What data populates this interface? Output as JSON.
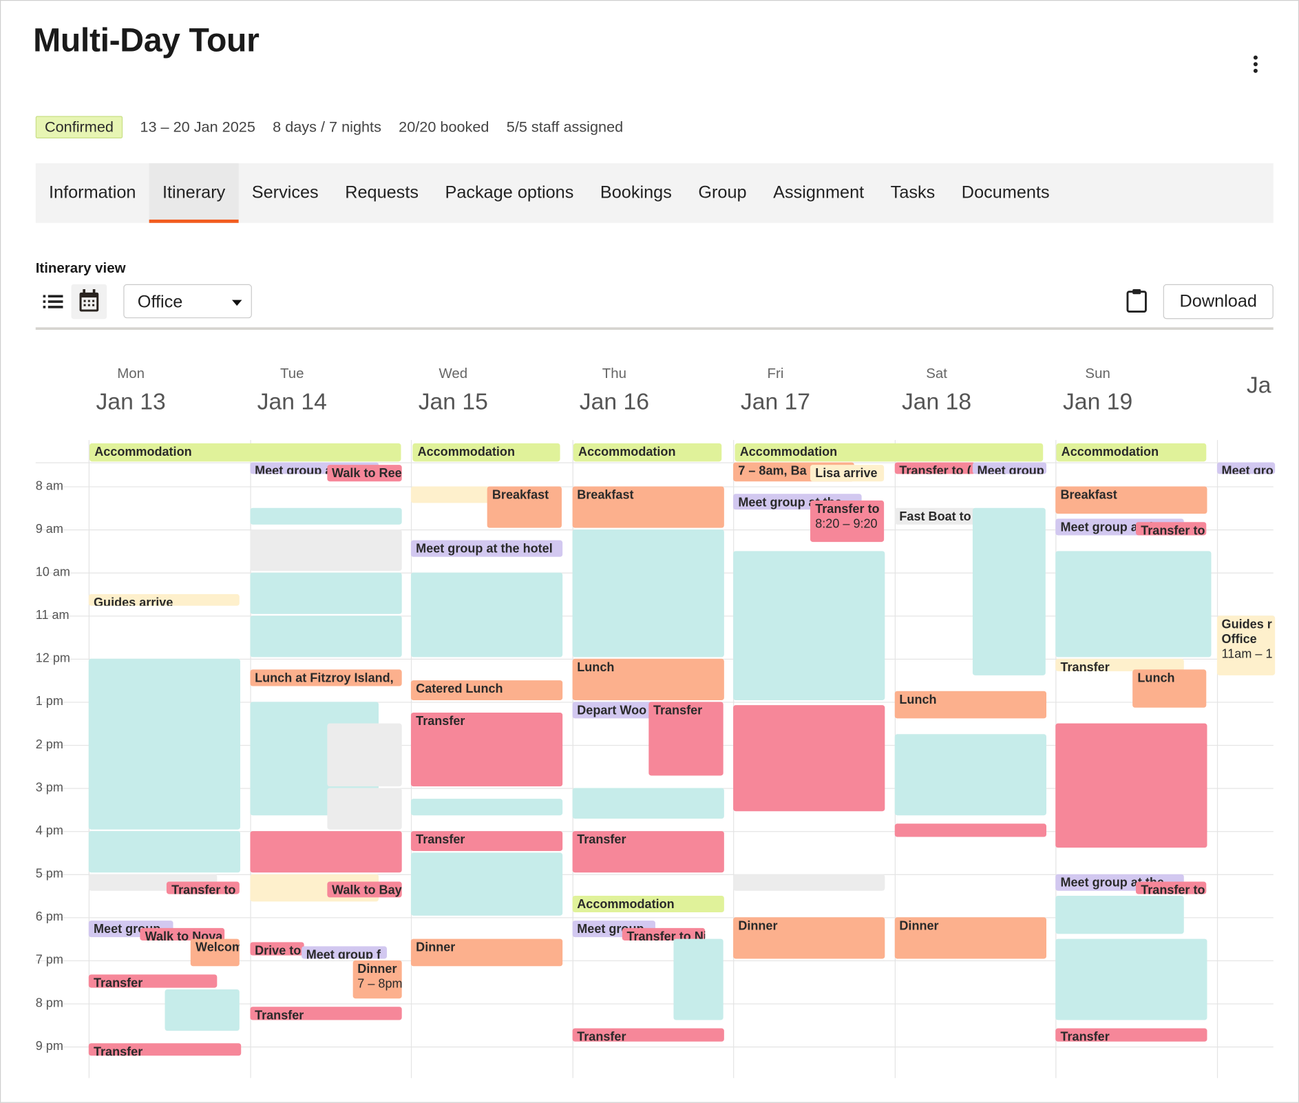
{
  "header": {
    "title": "Multi-Day Tour",
    "menu_icon": "kebab-vertical-icon"
  },
  "meta": {
    "status": "Confirmed",
    "dates": "13 – 20 Jan 2025",
    "duration": "8 days / 7 nights",
    "booked": "20/20 booked",
    "staff": "5/5 staff assigned"
  },
  "tabs": [
    {
      "label": "Information"
    },
    {
      "label": "Itinerary",
      "active": true
    },
    {
      "label": "Services"
    },
    {
      "label": "Requests"
    },
    {
      "label": "Package options"
    },
    {
      "label": "Bookings"
    },
    {
      "label": "Group"
    },
    {
      "label": "Assignment"
    },
    {
      "label": "Tasks"
    },
    {
      "label": "Documents"
    }
  ],
  "itinerary": {
    "view_label": "Itinerary view",
    "list_icon": "list-icon",
    "calendar_icon": "calendar-icon",
    "view_select": "Office",
    "clipboard_icon": "clipboard-icon",
    "download_label": "Download"
  },
  "colors": {
    "activity": "#c6ecea",
    "transfer": "#f68799",
    "meal": "#fcb08d",
    "meeting": "#d2c8f0",
    "note": "#fef0cc",
    "accommodation": "#e0f29a",
    "other": "#ececec",
    "accent": "#f25c1e"
  },
  "time_labels": [
    "8 am",
    "9 am",
    "10 am",
    "11 am",
    "12 pm",
    "1 pm",
    "2 pm",
    "3 pm",
    "4 pm",
    "5 pm",
    "6 pm",
    "7 pm",
    "8 pm",
    "9 pm"
  ],
  "all_day": [
    {
      "label": "Accommodation",
      "from": "Jan 13",
      "to": "Jan 14"
    },
    {
      "label": "Accommodation",
      "from": "Jan 15",
      "to": "Jan 15"
    },
    {
      "label": "Accommodation",
      "from": "Jan 16",
      "to": "Jan 16"
    },
    {
      "label": "Accommodation",
      "from": "Jan 17",
      "to": "Jan 18"
    },
    {
      "label": "Accommodation",
      "from": "Jan 19",
      "to": "Jan 19"
    }
  ],
  "days": [
    {
      "day": "Mon",
      "date": "Jan 13",
      "events": [
        {
          "label": "Guides arrive",
          "start": "10:30",
          "end": "10:45",
          "kind": "note"
        },
        {
          "start": "12:00",
          "end": "16:00",
          "kind": "activity"
        },
        {
          "start": "16:00",
          "end": "17:00",
          "kind": "activity"
        },
        {
          "start": "17:00",
          "end": "17:25",
          "kind": "other"
        },
        {
          "label": "Transfer to I",
          "start": "17:10",
          "end": "17:30",
          "kind": "transfer"
        },
        {
          "label": "Meet group",
          "start": "18:05",
          "end": "18:30",
          "kind": "meeting"
        },
        {
          "label": "Walk to Nova",
          "start": "18:15",
          "end": "18:35",
          "kind": "transfer"
        },
        {
          "label": "Welcome",
          "start": "18:30",
          "end": "19:10",
          "kind": "meal"
        },
        {
          "label": "Transfer",
          "start": "19:20",
          "end": "19:40",
          "kind": "transfer"
        },
        {
          "start": "19:40",
          "end": "20:40",
          "kind": "activity"
        },
        {
          "label": "Transfer",
          "start": "20:55",
          "end": "21:15",
          "kind": "transfer"
        }
      ]
    },
    {
      "day": "Tue",
      "date": "Jan 14",
      "events": [
        {
          "label": "Meet group at the hotel",
          "start": "07:25",
          "end": "07:45",
          "kind": "meeting"
        },
        {
          "label": "Walk to Reef",
          "start": "07:30",
          "end": "07:55",
          "kind": "transfer"
        },
        {
          "start": "08:30",
          "end": "08:55",
          "kind": "activity"
        },
        {
          "start": "09:00",
          "end": "10:00",
          "kind": "other"
        },
        {
          "start": "10:00",
          "end": "11:00",
          "kind": "activity"
        },
        {
          "start": "11:00",
          "end": "12:00",
          "kind": "activity"
        },
        {
          "label": "Lunch at Fitzroy Island,",
          "start": "12:15",
          "end": "12:40",
          "kind": "meal"
        },
        {
          "start": "13:00",
          "end": "15:40",
          "kind": "activity"
        },
        {
          "start": "13:30",
          "end": "15:00",
          "kind": "other"
        },
        {
          "start": "15:00",
          "end": "16:00",
          "kind": "other"
        },
        {
          "start": "16:00",
          "end": "17:00",
          "kind": "transfer"
        },
        {
          "start": "17:00",
          "end": "17:40",
          "kind": "note"
        },
        {
          "label": "Walk to Bay",
          "start": "17:10",
          "end": "17:35",
          "kind": "transfer"
        },
        {
          "label": "Drive to",
          "start": "18:35",
          "end": "18:55",
          "kind": "transfer"
        },
        {
          "label": "Meet group f",
          "start": "18:40",
          "end": "19:00",
          "kind": "meeting"
        },
        {
          "label": "Dinner",
          "sub": "7 – 8pm",
          "start": "19:00",
          "end": "19:55",
          "kind": "meal"
        },
        {
          "label": "Transfer",
          "start": "20:05",
          "end": "20:25",
          "kind": "transfer"
        }
      ]
    },
    {
      "day": "Wed",
      "date": "Jan 15",
      "events": [
        {
          "start": "08:00",
          "end": "08:25",
          "kind": "note"
        },
        {
          "label": "Breakfast",
          "start": "08:00",
          "end": "09:00",
          "kind": "meal"
        },
        {
          "label": "Meet group at the hotel",
          "start": "09:15",
          "end": "09:40",
          "kind": "meeting"
        },
        {
          "start": "10:00",
          "end": "12:00",
          "kind": "activity"
        },
        {
          "label": "Catered Lunch",
          "start": "12:30",
          "end": "13:00",
          "kind": "meal"
        },
        {
          "label": "Transfer",
          "start": "13:15",
          "end": "15:00",
          "kind": "transfer"
        },
        {
          "start": "15:15",
          "end": "15:40",
          "kind": "activity"
        },
        {
          "label": "Transfer",
          "start": "16:00",
          "end": "16:30",
          "kind": "transfer"
        },
        {
          "start": "16:30",
          "end": "18:00",
          "kind": "activity"
        },
        {
          "label": "Dinner",
          "start": "18:30",
          "end": "19:10",
          "kind": "meal"
        }
      ]
    },
    {
      "day": "Thu",
      "date": "Jan 16",
      "events": [
        {
          "label": "Breakfast",
          "start": "08:00",
          "end": "09:00",
          "kind": "meal"
        },
        {
          "start": "09:00",
          "end": "12:00",
          "kind": "activity"
        },
        {
          "label": "Lunch",
          "start": "12:00",
          "end": "13:00",
          "kind": "meal"
        },
        {
          "label": "Depart Woo",
          "start": "13:00",
          "end": "13:25",
          "kind": "meeting"
        },
        {
          "label": "Transfer",
          "start": "13:00",
          "end": "14:45",
          "kind": "transfer"
        },
        {
          "start": "15:00",
          "end": "15:45",
          "kind": "activity"
        },
        {
          "label": "Transfer",
          "start": "16:00",
          "end": "17:00",
          "kind": "transfer"
        },
        {
          "label": "Accommodation",
          "start": "17:30",
          "end": "17:55",
          "kind": "accommodation"
        },
        {
          "label": "Meet group",
          "start": "18:05",
          "end": "18:30",
          "kind": "meeting"
        },
        {
          "label": "Transfer to Ni",
          "start": "18:15",
          "end": "18:35",
          "kind": "transfer"
        },
        {
          "start": "18:30",
          "end": "20:25",
          "kind": "activity"
        },
        {
          "label": "Transfer",
          "start": "20:35",
          "end": "20:55",
          "kind": "transfer"
        }
      ]
    },
    {
      "day": "Fri",
      "date": "Jan 17",
      "events": [
        {
          "label": "7 – 8am, Ba",
          "start": "07:25",
          "end": "07:55",
          "kind": "meal"
        },
        {
          "label": "Lisa arrive",
          "start": "07:30",
          "end": "07:55",
          "kind": "note"
        },
        {
          "label": "Meet group at the",
          "start": "08:10",
          "end": "08:35",
          "kind": "meeting"
        },
        {
          "label": "Transfer to",
          "sub": "8:20 – 9:20",
          "start": "08:20",
          "end": "09:20",
          "kind": "transfer"
        },
        {
          "start": "09:30",
          "end": "13:00",
          "kind": "activity"
        },
        {
          "start": "13:05",
          "end": "15:35",
          "kind": "transfer"
        },
        {
          "start": "17:00",
          "end": "17:25",
          "kind": "other"
        },
        {
          "label": "Dinner",
          "start": "18:00",
          "end": "19:00",
          "kind": "meal"
        }
      ]
    },
    {
      "day": "Sat",
      "date": "Jan 18",
      "events": [
        {
          "label": "Transfer to (",
          "start": "07:25",
          "end": "07:45",
          "kind": "transfer"
        },
        {
          "label": "Meet group",
          "start": "07:25",
          "end": "07:45",
          "kind": "meeting"
        },
        {
          "label": "Fast Boat to",
          "start": "08:30",
          "end": "08:55",
          "kind": "other"
        },
        {
          "start": "08:30",
          "end": "12:25",
          "kind": "activity"
        },
        {
          "label": "Lunch",
          "start": "12:45",
          "end": "13:25",
          "kind": "meal"
        },
        {
          "start": "13:45",
          "end": "15:40",
          "kind": "activity"
        },
        {
          "start": "15:50",
          "end": "16:10",
          "kind": "transfer"
        },
        {
          "label": "Dinner",
          "start": "18:00",
          "end": "19:00",
          "kind": "meal"
        }
      ]
    },
    {
      "day": "Sun",
      "date": "Jan 19",
      "events": [
        {
          "label": "Breakfast",
          "start": "08:00",
          "end": "08:40",
          "kind": "meal"
        },
        {
          "label": "Meet group at the",
          "start": "08:45",
          "end": "09:10",
          "kind": "meeting"
        },
        {
          "label": "Transfer to",
          "start": "08:50",
          "end": "09:10",
          "kind": "transfer"
        },
        {
          "start": "09:30",
          "end": "12:00",
          "kind": "activity"
        },
        {
          "label": "Transfer",
          "start": "12:00",
          "end": "12:20",
          "kind": "note"
        },
        {
          "label": "Lunch",
          "start": "12:15",
          "end": "13:10",
          "kind": "meal"
        },
        {
          "start": "13:30",
          "end": "16:25",
          "kind": "transfer"
        },
        {
          "label": "Meet group at the",
          "start": "17:00",
          "end": "17:25",
          "kind": "meeting"
        },
        {
          "label": "Transfer to I",
          "start": "17:10",
          "end": "17:30",
          "kind": "transfer"
        },
        {
          "start": "17:30",
          "end": "18:25",
          "kind": "activity"
        },
        {
          "start": "18:30",
          "end": "20:25",
          "kind": "activity"
        },
        {
          "label": "Transfer",
          "start": "20:35",
          "end": "20:55",
          "kind": "transfer"
        }
      ]
    },
    {
      "day": "",
      "date": "Ja",
      "events": [
        {
          "label": "Meet gro",
          "start": "07:25",
          "end": "07:45",
          "kind": "meeting"
        },
        {
          "label": "Guides r",
          "sub": "Office",
          "sub2": "11am – 1",
          "start": "11:00",
          "end": "12:25",
          "kind": "note"
        }
      ]
    }
  ]
}
